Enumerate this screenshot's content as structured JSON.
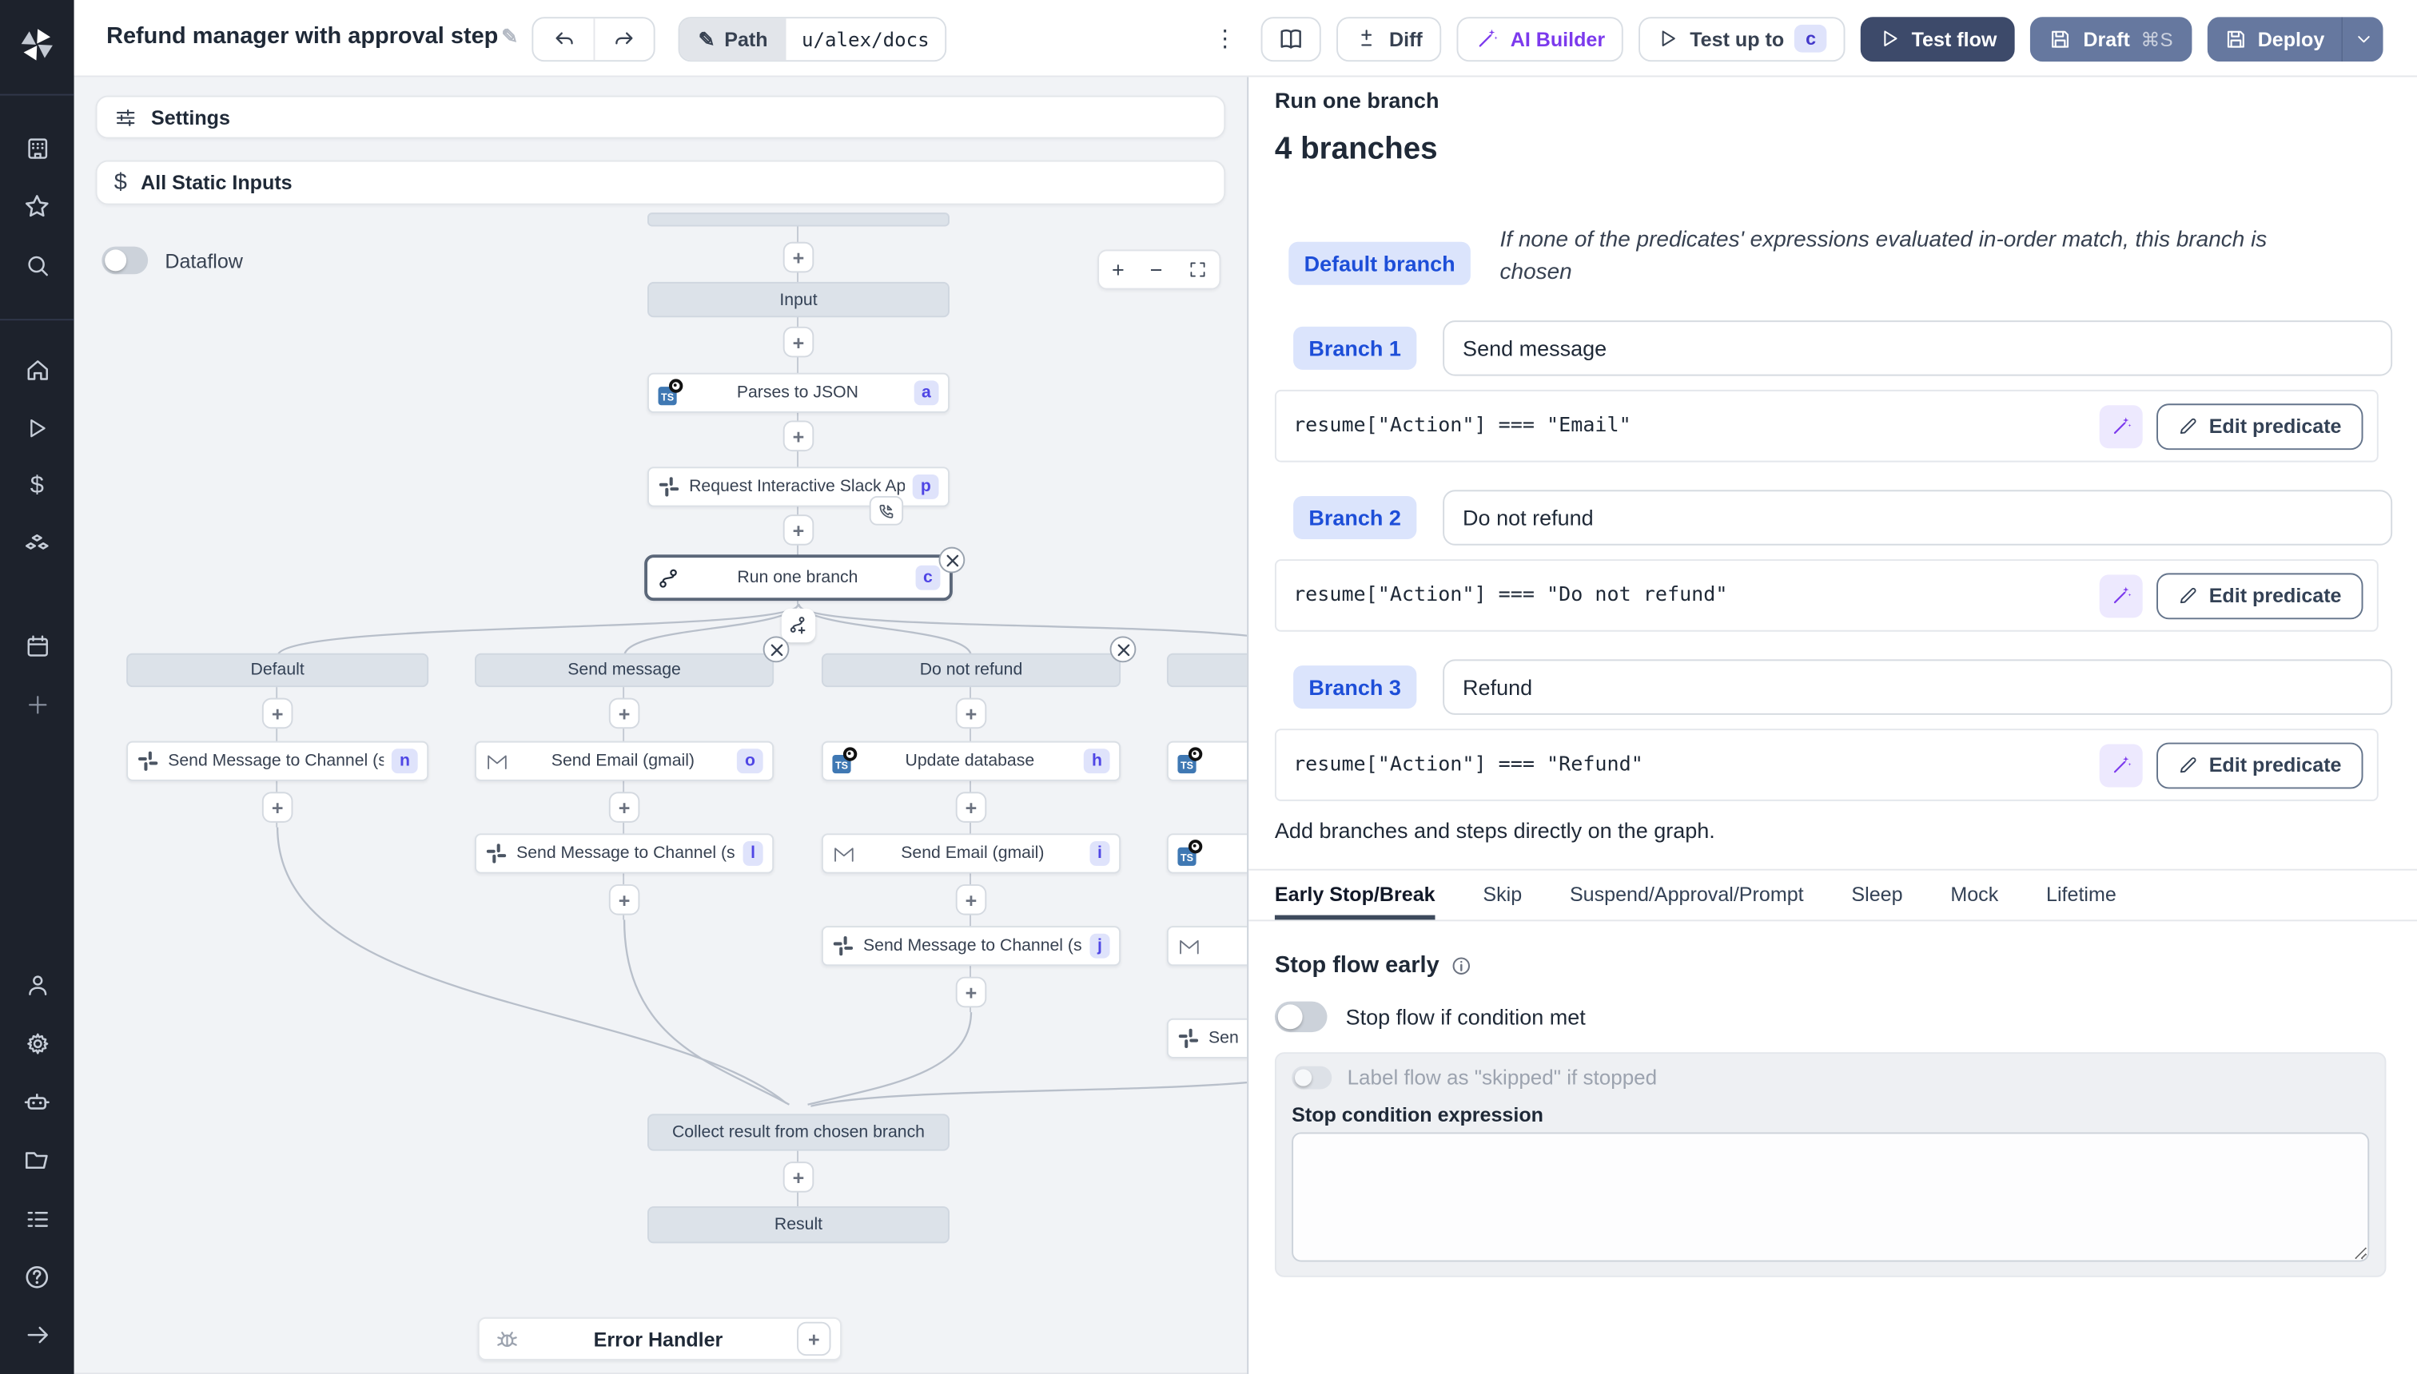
{
  "header": {
    "title": "Refund manager with approval step",
    "path": {
      "label": "Path",
      "value": "u/alex/docs"
    },
    "diff": "Diff",
    "ai_builder": "AI Builder",
    "test_up_to": {
      "label": "Test up to",
      "badge": "c"
    },
    "test_flow": "Test flow",
    "draft": {
      "label": "Draft",
      "shortcut": "⌘S"
    },
    "deploy": "Deploy"
  },
  "canvas": {
    "settings": "Settings",
    "all_static_inputs": "All Static Inputs",
    "dataflow": "Dataflow"
  },
  "graph": {
    "input": "Input",
    "steps": [
      {
        "label": "Parses to JSON",
        "badge": "a",
        "icon": "typescript"
      },
      {
        "label": "Request Interactive Slack Approval (...",
        "badge": "p",
        "icon": "slack"
      },
      {
        "label": "Run one branch",
        "badge": "c",
        "icon": "branch"
      }
    ],
    "columns": [
      {
        "header": "Default",
        "steps": [
          {
            "label": "Send Message to Channel (slack)",
            "badge": "n",
            "icon": "slack"
          }
        ]
      },
      {
        "header": "Send message",
        "steps": [
          {
            "label": "Send Email (gmail)",
            "badge": "o",
            "icon": "gmail"
          },
          {
            "label": "Send Message to Channel (slack)",
            "badge": "l",
            "icon": "slack"
          }
        ]
      },
      {
        "header": "Do not refund",
        "steps": [
          {
            "label": "Update database",
            "badge": "h",
            "icon": "typescript"
          },
          {
            "label": "Send Email (gmail)",
            "badge": "i",
            "icon": "gmail"
          },
          {
            "label": "Send Message to Channel (slack)",
            "badge": "j",
            "icon": "slack"
          }
        ]
      },
      {
        "header": "",
        "steps": [
          {
            "label": "",
            "icon": "typescript"
          },
          {
            "label": "",
            "icon": "typescript"
          },
          {
            "label": "",
            "icon": "gmail"
          },
          {
            "label": "Sen",
            "icon": "slack"
          }
        ]
      }
    ],
    "collect": "Collect result from chosen branch",
    "result": "Result",
    "error_handler": "Error Handler"
  },
  "panel": {
    "title": "Run one branch",
    "subtitle": "4 branches",
    "default_branch": {
      "badge": "Default branch",
      "description": "If none of the predicates' expressions evaluated in-order match, this branch is chosen"
    },
    "edit_predicate": "Edit predicate",
    "branches": [
      {
        "badge": "Branch 1",
        "summary": "Send message",
        "predicate": "resume[\"Action\"] === \"Email\""
      },
      {
        "badge": "Branch 2",
        "summary": "Do not refund",
        "predicate": "resume[\"Action\"] === \"Do not refund\""
      },
      {
        "badge": "Branch 3",
        "summary": "Refund",
        "predicate": "resume[\"Action\"] === \"Refund\""
      }
    ],
    "hint": "Add branches and steps directly on the graph.",
    "tabs": [
      "Early Stop/Break",
      "Skip",
      "Suspend/Approval/Prompt",
      "Sleep",
      "Mock",
      "Lifetime"
    ],
    "early_stop": {
      "heading": "Stop flow early",
      "condition_toggle": "Stop flow if condition met",
      "skipped_toggle": "Label flow as \"skipped\" if stopped",
      "expression_label": "Stop condition expression"
    }
  },
  "colors": {
    "primary_dark": "#3d4a6a",
    "secondary_slate": "#66789f",
    "badge_bg": "#dfe3fb",
    "badge_text": "#4f46e5",
    "branch_pill_bg": "#dbe4fc",
    "branch_pill_text": "#1d4ed8",
    "ai_purple": "#7c3aed",
    "sidebar_bg": "#1d222c",
    "canvas_bg": "#f1f3f6"
  }
}
